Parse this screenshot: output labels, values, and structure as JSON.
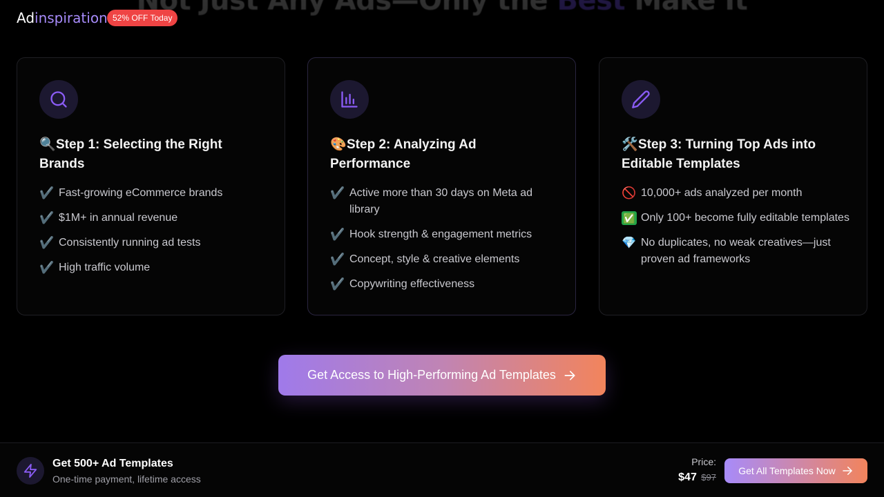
{
  "hero": {
    "title_pre": "Not Just Any Ads—Only the ",
    "title_accent": "Best",
    "title_post": " Make It"
  },
  "brand": {
    "name_part1": "Ad",
    "name_part2": "inspiration"
  },
  "promo_badge": "52% OFF Today",
  "steps": [
    {
      "icon": "search-icon",
      "emoji": "🔍",
      "title": "Step 1: Selecting the Right Brands",
      "items": [
        {
          "marker": "✔️",
          "text": "Fast-growing eCommerce brands"
        },
        {
          "marker": "✔️",
          "text": "$1M+ in annual revenue"
        },
        {
          "marker": "✔️",
          "text": "Consistently running ad tests"
        },
        {
          "marker": "✔️",
          "text": "High traffic volume"
        }
      ]
    },
    {
      "icon": "bar-chart-icon",
      "emoji": "🎨",
      "title": "Step 2: Analyzing Ad Performance",
      "items": [
        {
          "marker": "✔️",
          "text": "Active more than 30 days on Meta ad library"
        },
        {
          "marker": "✔️",
          "text": "Hook strength & engagement metrics"
        },
        {
          "marker": "✔️",
          "text": "Concept, style & creative elements"
        },
        {
          "marker": "✔️",
          "text": "Copywriting effectiveness"
        }
      ]
    },
    {
      "icon": "pencil-icon",
      "emoji": "🛠️",
      "title": "Step 3: Turning Top Ads into Editable Templates",
      "items": [
        {
          "marker": "🚫",
          "text": "10,000+ ads analyzed per month"
        },
        {
          "marker": "✅",
          "text": "Only 100+ become fully editable templates"
        },
        {
          "marker": "💎",
          "text": "No duplicates, no weak creatives—just proven ad frameworks"
        }
      ]
    }
  ],
  "cta": {
    "label": "Get Access to High-Performing Ad Templates"
  },
  "bottom_bar": {
    "title": "Get 500+ Ad Templates",
    "subtitle": "One-time payment, lifetime access",
    "price_label": "Price:",
    "price_now": "$47",
    "price_old": "$97",
    "button_label": "Get All Templates Now"
  },
  "colors": {
    "accent_purple": "#a78bfa",
    "accent_orange": "#f2845c",
    "badge_red": "#ef4444",
    "background": "#000000"
  }
}
